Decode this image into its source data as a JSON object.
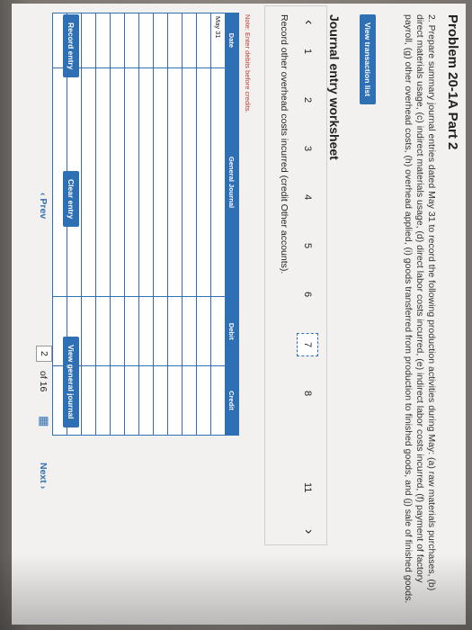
{
  "problem": {
    "title": "Problem 20-1A Part 2",
    "text": "2. Prepare summary journal entries dated May 31 to record the following production activities during May: (a) raw materials purchases, (b) direct materials usage, (c) indirect materials usage, (d) direct labor costs incurred, (e) indirect labor costs incurred, (f) payment of factory payroll, (g) other overhead costs, (h) overhead applied, (i) goods transferred from production to finished goods, and (j) sale of finished goods."
  },
  "buttons": {
    "view_transaction_list": "View transaction list",
    "record_entry": "Record entry",
    "clear_entry": "Clear entry",
    "view_general_journal": "View general journal"
  },
  "worksheet": {
    "title": "Journal entry worksheet",
    "pages": [
      "1",
      "2",
      "3",
      "4",
      "5",
      "6",
      "7",
      "8",
      "11"
    ],
    "current_page": "7",
    "instruction": "Record other overhead costs incurred (credit Other accounts).",
    "note": "Note: Enter debits before credits."
  },
  "table": {
    "headers": [
      "Date",
      "General Journal",
      "Debit",
      "Credit"
    ],
    "first_date": "May 31",
    "rows": 12
  },
  "nav": {
    "prev": "Prev",
    "current": "2",
    "of": "of 16",
    "next": "Next"
  },
  "colors": {
    "accent": "#2f6fb3",
    "note": "#c0392b"
  }
}
